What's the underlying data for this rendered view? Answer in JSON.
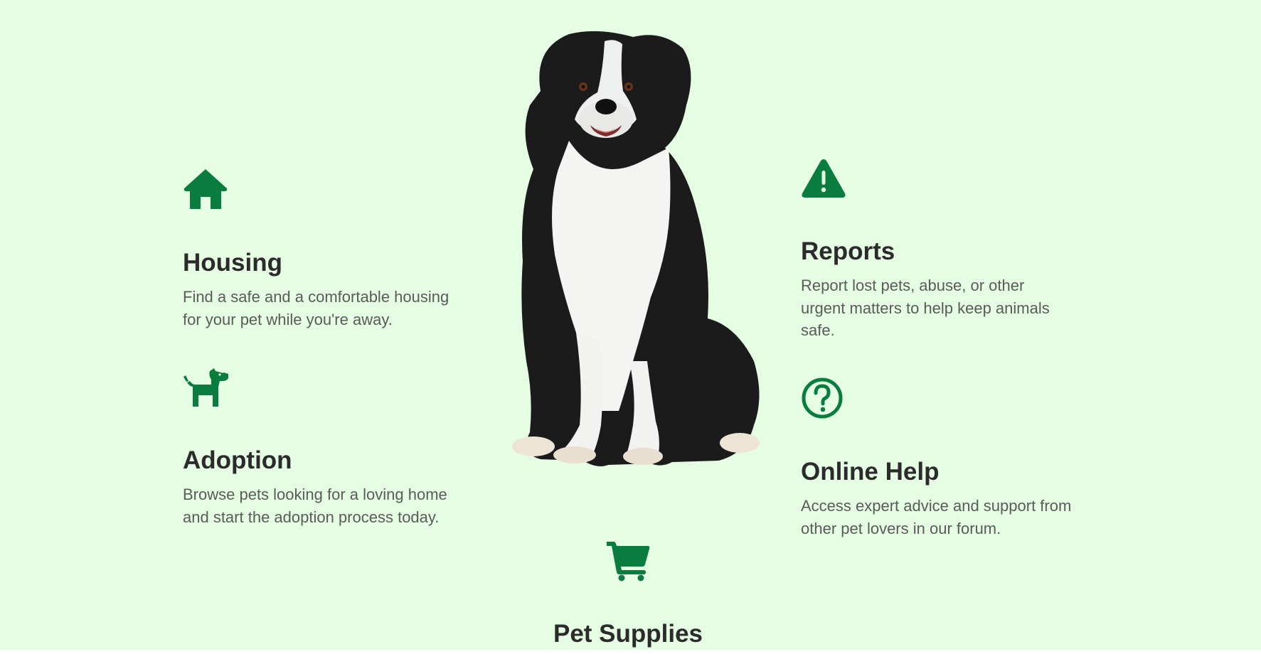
{
  "colors": {
    "background": "#e4fde3",
    "accent": "#0a7d3e",
    "heading": "#2b2b2b",
    "body_text": "#5b5b5b"
  },
  "services": {
    "housing": {
      "icon": "house-icon",
      "title": "Housing",
      "description": "Find a safe and a comfortable housing for your pet while you're away."
    },
    "adoption": {
      "icon": "dog-icon",
      "title": "Adoption",
      "description": "Browse pets looking for a loving home and start the adoption process today."
    },
    "reports": {
      "icon": "warning-icon",
      "title": "Reports",
      "description": "Report lost pets, abuse, or other urgent matters to help keep animals safe."
    },
    "online_help": {
      "icon": "question-circle-icon",
      "title": "Online Help",
      "description": "Access expert advice and support from other pet lovers in our forum."
    },
    "pet_supplies": {
      "icon": "shopping-cart-icon",
      "title": "Pet Supplies"
    }
  },
  "hero_image": {
    "subject": "border-collie-dog-photo"
  }
}
